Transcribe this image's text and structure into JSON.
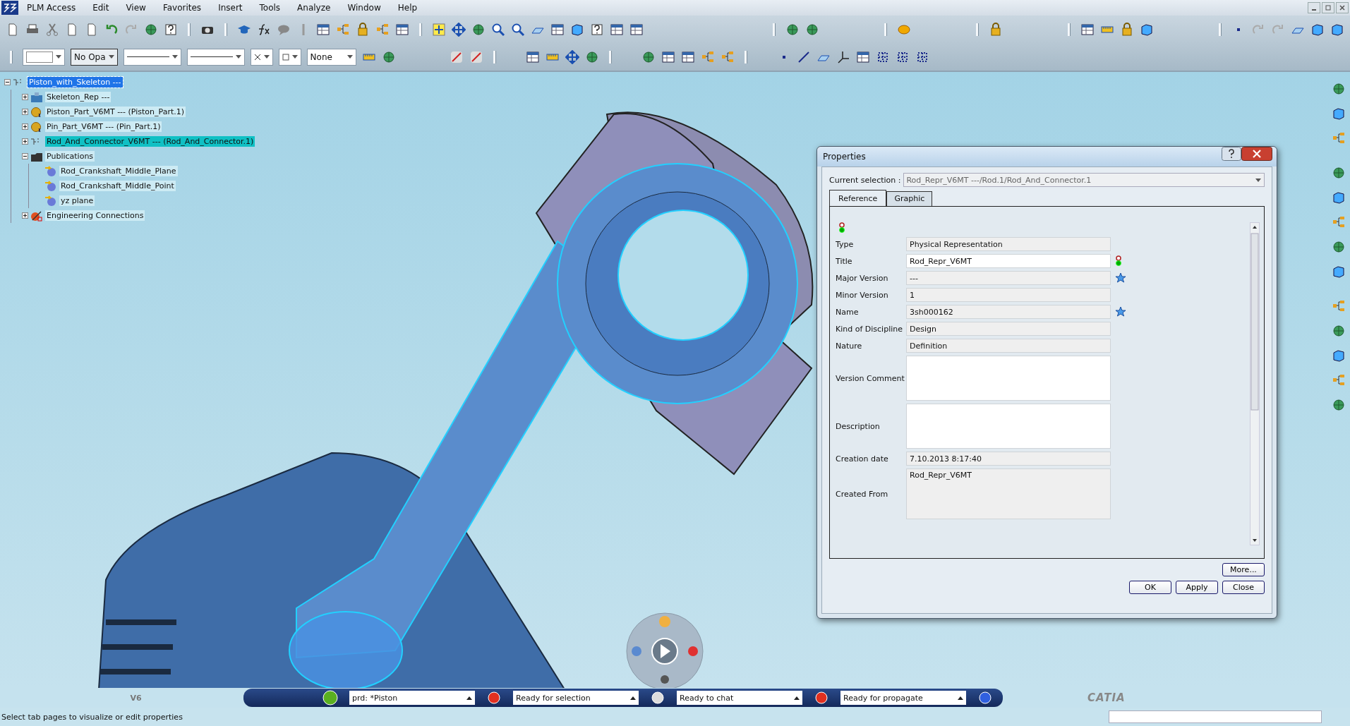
{
  "menu_bar": [
    "PLM Access",
    "Edit",
    "View",
    "Favorites",
    "Insert",
    "Tools",
    "Analyze",
    "Window",
    "Help"
  ],
  "format_toolbar": {
    "opacity": "No Opa",
    "layer": "None"
  },
  "tree": {
    "items": [
      {
        "label": "Piston_with_Skeleton ---",
        "kind": "product",
        "expanded": true,
        "selected": true,
        "highlighted": false,
        "children": [
          {
            "label": "Skeleton_Rep ---",
            "kind": "skeleton",
            "expanded": false,
            "selected": false,
            "highlighted": false
          },
          {
            "label": "Piston_Part_V6MT --- (Piston_Part.1)",
            "kind": "part",
            "expanded": false,
            "selected": false,
            "highlighted": false
          },
          {
            "label": "Pin_Part_V6MT --- (Pin_Part.1)",
            "kind": "part",
            "expanded": false,
            "selected": false,
            "highlighted": false
          },
          {
            "label": "Rod_And_Connector_V6MT --- (Rod_And_Connector.1)",
            "kind": "product",
            "expanded": false,
            "selected": false,
            "highlighted": true
          },
          {
            "label": "Publications",
            "kind": "folder",
            "expanded": true,
            "selected": false,
            "highlighted": false,
            "children": [
              {
                "label": "Rod_Crankshaft_Middle_Plane",
                "kind": "publication",
                "selected": false,
                "highlighted": false
              },
              {
                "label": "Rod_Crankshaft_Middle_Point",
                "kind": "publication",
                "selected": false,
                "highlighted": false
              },
              {
                "label": "yz plane",
                "kind": "publication",
                "selected": false,
                "highlighted": false
              }
            ]
          },
          {
            "label": "Engineering Connections",
            "kind": "connections",
            "expanded": false,
            "selected": false,
            "highlighted": false
          }
        ]
      }
    ]
  },
  "properties_dialog": {
    "title": "Properties",
    "current_selection": {
      "label": "Current selection :",
      "value": "Rod_Repr_V6MT ---/Rod.1/Rod_And_Connector.1"
    },
    "tabs": [
      {
        "label": "Reference",
        "selected": true
      },
      {
        "label": "Graphic",
        "selected": false
      }
    ],
    "fields": [
      {
        "label": "Type",
        "value": "Physical Representation",
        "kind": "single",
        "editable": false,
        "locked": false,
        "starred": false
      },
      {
        "label": "Title",
        "value": "Rod_Repr_V6MT",
        "kind": "single",
        "editable": true,
        "locked": true,
        "starred": false
      },
      {
        "label": "Major Version",
        "value": "---",
        "kind": "single",
        "editable": false,
        "locked": false,
        "starred": true
      },
      {
        "label": "Minor Version",
        "value": "1",
        "kind": "single",
        "editable": false,
        "locked": false,
        "starred": false
      },
      {
        "label": "Name",
        "value": "3sh000162",
        "kind": "single",
        "editable": false,
        "locked": false,
        "starred": true
      },
      {
        "label": "Kind of Discipline",
        "value": "Design",
        "kind": "single",
        "editable": false,
        "locked": false,
        "starred": false
      },
      {
        "label": "Nature",
        "value": "Definition",
        "kind": "single",
        "editable": false,
        "locked": false,
        "starred": false
      },
      {
        "label": "Version Comment",
        "kind": "multi",
        "editable": true,
        "locked": false,
        "starred": false
      },
      {
        "label": "Description",
        "kind": "multi",
        "editable": true,
        "locked": false,
        "starred": false
      },
      {
        "label": "Creation date",
        "value": "7.10.2013 8:17:40",
        "kind": "single",
        "editable": false,
        "locked": false,
        "starred": false
      },
      {
        "label": "Created From",
        "value": "Rod_Repr_V6MT",
        "kind": "multi",
        "editable": false,
        "locked": false,
        "starred": false
      }
    ],
    "more_button": "More...",
    "buttons": [
      "OK",
      "Apply",
      "Close"
    ]
  },
  "brand": {
    "version": "V6",
    "product": "CATIA"
  },
  "compass_bar": [
    {
      "value": "prd: *Piston"
    },
    {
      "value": "Ready for selection"
    },
    {
      "value": "Ready to chat"
    },
    {
      "value": "Ready for propagate"
    }
  ],
  "status_bar": {
    "message": "Select tab pages to visualize or edit properties"
  }
}
